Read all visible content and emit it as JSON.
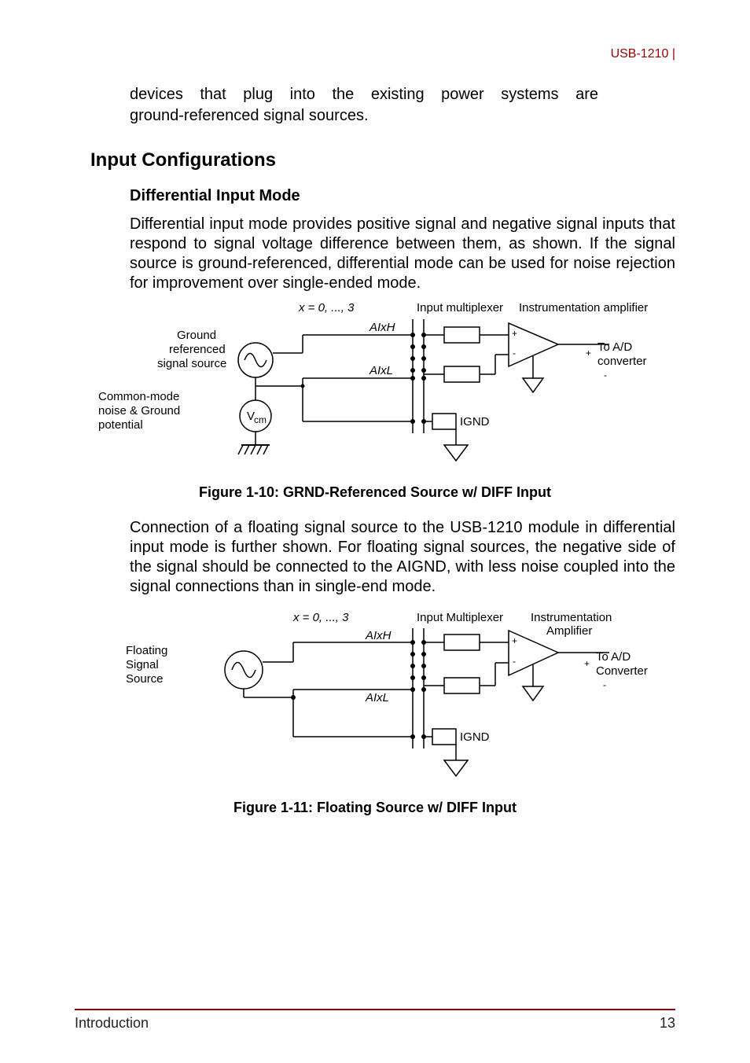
{
  "header": {
    "product": "USB-1210",
    "bar": "|"
  },
  "intro_line1": "devices that plug into the existing power systems are",
  "intro_line2": "ground-referenced signal sources.",
  "h2": "Input Configurations",
  "h3": "Differential Input Mode",
  "p1": "Differential input mode provides positive signal and negative signal inputs that respond to signal voltage difference between them, as shown. If the signal source is ground-referenced, differential mode can be used for noise rejection for improvement over single-ended mode.",
  "fig1": {
    "x_range": "x = 0, ..., 3",
    "mux": "Input multiplexer",
    "amp": "Instrumentation amplifier",
    "ground_ref0": "Ground",
    "ground_ref1": "referenced",
    "ground_ref2": "signal source",
    "aixh": "AIxH",
    "aixl": "AIxL",
    "toad0": "To A/D",
    "toad1": "converter",
    "cm0": "Common-mode",
    "cm1": "noise & Ground",
    "cm2": "potential",
    "vcm": "V",
    "vcm_sub": "cm",
    "ignd": "IGND",
    "plus": "+",
    "minus": "-",
    "caption": "Figure 1-10: GRND-Referenced Source w/ DIFF Input"
  },
  "p2": "Connection of a floating signal source to the USB-1210 module in differential input mode is further shown. For floating signal sources, the negative side of the signal should be connected to the AIGND, with less noise coupled into the signal connections than in single-end mode.",
  "fig2": {
    "x_range": "x = 0, ..., 3",
    "mux": "Input Multiplexer",
    "amp0": "Instrumentation",
    "amp1": "Amplifier",
    "float0": "Floating",
    "float1": "Signal",
    "float2": "Source",
    "aixh": "AIxH",
    "aixl": "AIxL",
    "toad0": "To A/D",
    "toad1": "Converter",
    "ignd": "IGND",
    "plus": "+",
    "minus": "-",
    "caption": "Figure 1-11: Floating Source w/ DIFF Input"
  },
  "footer": {
    "section": "Introduction",
    "page": "13"
  }
}
